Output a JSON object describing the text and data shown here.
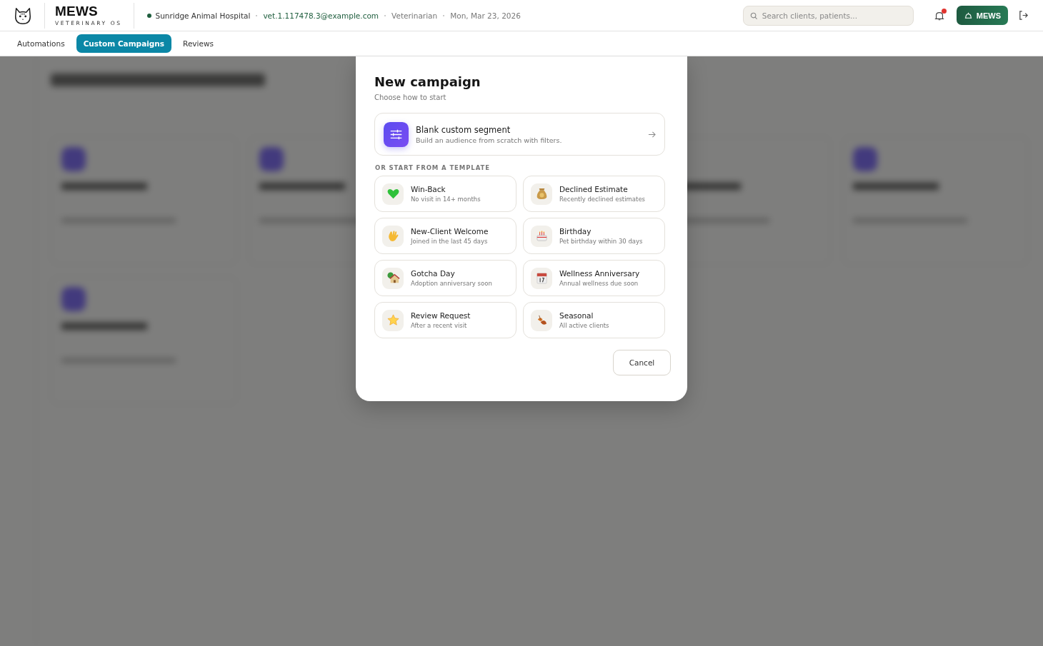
{
  "header": {
    "brand": "MEWS",
    "tagline": "VETERINARY OS",
    "clinic": "Sunridge Animal Hospital",
    "email": "vet.1.117478.3@example.com",
    "role": "Veterinarian",
    "date": "Mon, Mar 23, 2026",
    "search": {
      "placeholder": "Search clients, patients..."
    },
    "notifications_unread": true,
    "account_button": "MEWS"
  },
  "tabs": [
    {
      "label": "Automations",
      "selected": false
    },
    {
      "label": "Custom Campaigns",
      "selected": true
    },
    {
      "label": "Reviews",
      "selected": false
    }
  ],
  "dialog": {
    "title": "New campaign",
    "subtitle": "Choose how to start",
    "blank_option": {
      "title": "Blank custom segment",
      "description": "Build an audience from scratch with filters."
    },
    "section_label": "OR START FROM A TEMPLATE",
    "templates": [
      {
        "title": "Win-Back",
        "description": "No visit in 14+ months"
      },
      {
        "title": "Declined Estimate",
        "description": "Recently declined estimates"
      },
      {
        "title": "New-Client Welcome",
        "description": "Joined in the last 45 days"
      },
      {
        "title": "Birthday",
        "description": "Pet birthday within 30 days"
      },
      {
        "title": "Gotcha Day",
        "description": "Adoption anniversary soon"
      },
      {
        "title": "Wellness Anniversary",
        "description": "Annual wellness due soon"
      },
      {
        "title": "Review Request",
        "description": "After a recent visit"
      },
      {
        "title": "Seasonal",
        "description": "All active clients"
      }
    ],
    "cancel_button": "Cancel"
  }
}
